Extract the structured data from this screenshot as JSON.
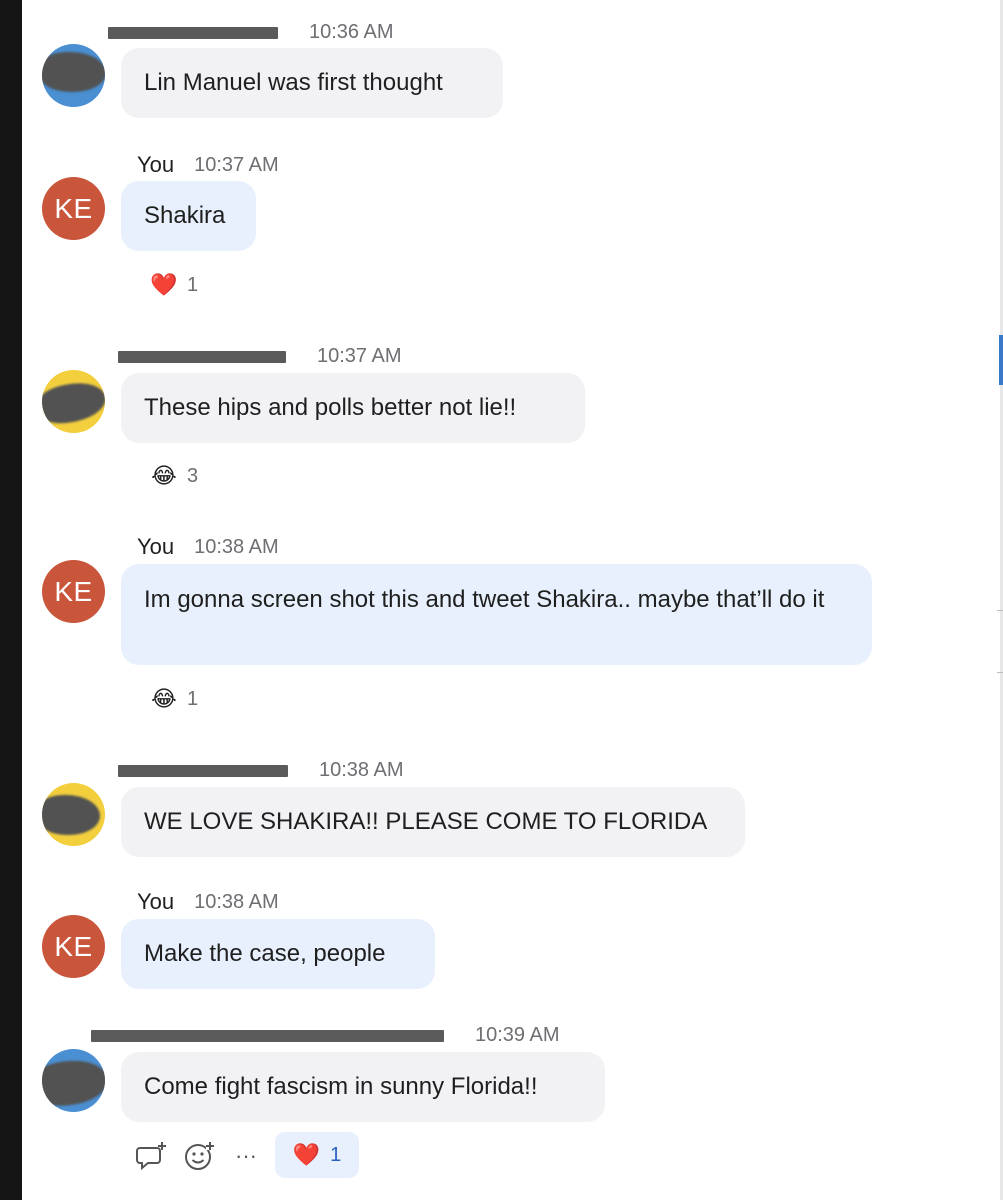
{
  "messages": [
    {
      "sender": "",
      "time": "10:36 AM",
      "avatar_type": "blue-redacted",
      "text": "Lin Manuel was first thought",
      "from_me": false
    },
    {
      "sender": "You",
      "time": "10:37 AM",
      "avatar_initials": "KE",
      "text": "Shakira",
      "from_me": true,
      "reaction": {
        "icon": "heart-icon",
        "emoji": "❤️",
        "count": "1"
      }
    },
    {
      "sender": "",
      "time": "10:37 AM",
      "avatar_type": "yellow-redacted",
      "text": "These hips and polls better not lie!!",
      "from_me": false,
      "reaction": {
        "icon": "tears-of-joy-icon",
        "emoji": "😂",
        "count": "3"
      }
    },
    {
      "sender": "You",
      "time": "10:38 AM",
      "avatar_initials": "KE",
      "text": "Im gonna screen shot this and tweet Shakira.. maybe that’ll do it",
      "from_me": true,
      "reaction": {
        "icon": "tears-of-joy-icon",
        "emoji": "😂",
        "count": "1"
      }
    },
    {
      "sender": "",
      "time": "10:38 AM",
      "avatar_type": "yellow-redacted",
      "text": "WE LOVE SHAKIRA!! PLEASE COME TO FLORIDA",
      "from_me": false
    },
    {
      "sender": "You",
      "time": "10:38 AM",
      "avatar_initials": "KE",
      "text": "Make the case, people",
      "from_me": true
    },
    {
      "sender": "",
      "time": "10:39 AM",
      "avatar_type": "blue-redacted",
      "text": "Come fight fascism in sunny Florida!!",
      "from_me": false
    }
  ],
  "toolbar": {
    "reply_icon": "reply-in-thread-icon",
    "add_reaction_icon": "add-reaction-icon",
    "more_icon": "more-options-icon",
    "more_glyph": "···",
    "reaction": {
      "icon": "heart-icon",
      "emoji": "❤️",
      "count": "1"
    }
  },
  "colors": {
    "my_bubble": "#e7f0fc",
    "other_bubble": "#f2f2f5",
    "ke_avatar": "#c9553b",
    "accent": "#2a62c2"
  }
}
